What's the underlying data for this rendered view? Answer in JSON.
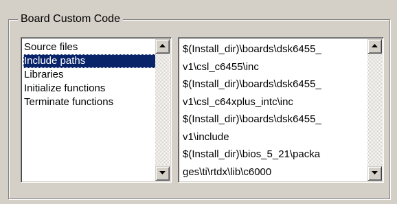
{
  "group": {
    "title": "Board Custom Code"
  },
  "left_list": {
    "items": [
      "Source files",
      "Include paths",
      "Libraries",
      "Initialize functions",
      "Terminate functions"
    ],
    "selected_index": 1
  },
  "right_list": {
    "lines": [
      "$(Install_dir)\\boards\\dsk6455_",
      "v1\\csl_c6455\\inc",
      "$(Install_dir)\\boards\\dsk6455_",
      "v1\\csl_c64xplus_intc\\inc",
      "$(Install_dir)\\boards\\dsk6455_",
      "v1\\include",
      "$(Install_dir)\\bios_5_21\\packa",
      "ges\\ti\\rtdx\\lib\\c6000"
    ]
  },
  "icons": {
    "scroll_up": "triangle-up-icon",
    "scroll_down": "triangle-down-icon"
  }
}
